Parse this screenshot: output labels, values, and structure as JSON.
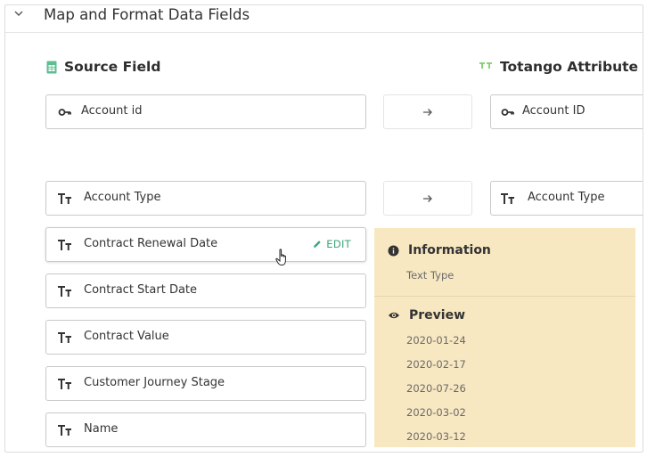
{
  "section": {
    "title": "Map and Format Data Fields"
  },
  "columns": {
    "source": "Source Field",
    "target": "Totango Attribute"
  },
  "source_fields": [
    {
      "label": "Account id",
      "icon": "key-icon"
    },
    {
      "label": "Account Type",
      "icon": "text-type-icon"
    },
    {
      "label": "Contract Renewal Date",
      "icon": "text-type-icon"
    },
    {
      "label": "Contract Start Date",
      "icon": "text-type-icon"
    },
    {
      "label": "Contract Value",
      "icon": "text-type-icon"
    },
    {
      "label": "Customer Journey Stage",
      "icon": "text-type-icon"
    },
    {
      "label": "Name",
      "icon": "text-type-icon"
    }
  ],
  "target_fields": [
    {
      "label": "Account ID",
      "icon": "key-icon"
    },
    {
      "label": "Account Type",
      "icon": "text-type-icon"
    }
  ],
  "edit": {
    "label": "EDIT"
  },
  "info_panel": {
    "information_title": "Information",
    "information_text": "Text Type",
    "preview_title": "Preview",
    "preview_values": [
      "2020-01-24",
      "2020-02-17",
      "2020-07-26",
      "2020-03-02",
      "2020-03-12"
    ]
  },
  "colors": {
    "accent": "#3aa57a",
    "panel_bg": "#f8e8c2",
    "border": "#c9c9c9"
  }
}
